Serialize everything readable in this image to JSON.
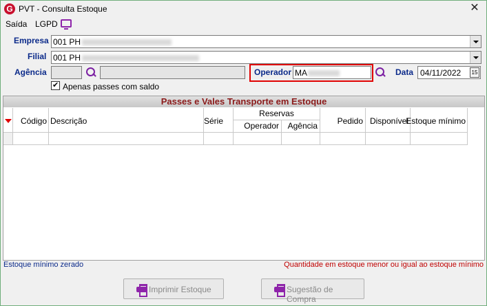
{
  "window": {
    "title": "PVT - Consulta Estoque",
    "close_glyph": "✕",
    "app_icon_letter": "G"
  },
  "menu": {
    "items": [
      "Saída",
      "LGPD"
    ]
  },
  "form": {
    "empresa_label": "Empresa",
    "empresa_value": "001 PH",
    "filial_label": "Filial",
    "filial_value": "001 PH",
    "agencia_label": "Agência",
    "agencia_code": "",
    "agencia_name": "",
    "operador_label": "Operador",
    "operador_value": "MA",
    "data_label": "Data",
    "data_value": "04/11/2022",
    "calendar_glyph": "15",
    "checkbox_label": "Apenas passes com saldo",
    "checkbox_checked": true
  },
  "grid": {
    "title": "Passes e Vales Transporte em Estoque",
    "columns": [
      "Código",
      "Descrição",
      "Série",
      "Reservas",
      "Operador",
      "Agência",
      "Pedido",
      "Disponível",
      "Estoque mínimo"
    ]
  },
  "legend": {
    "left": "Estoque mínimo zerado",
    "right": "Quantidade em estoque menor ou igual ao estoque mínimo",
    "left_color": "#0b2a8a",
    "right_color": "#c00000"
  },
  "buttons": {
    "imprimir": "Imprimir Estoque",
    "sugestao": "Sugestão de Compra"
  }
}
